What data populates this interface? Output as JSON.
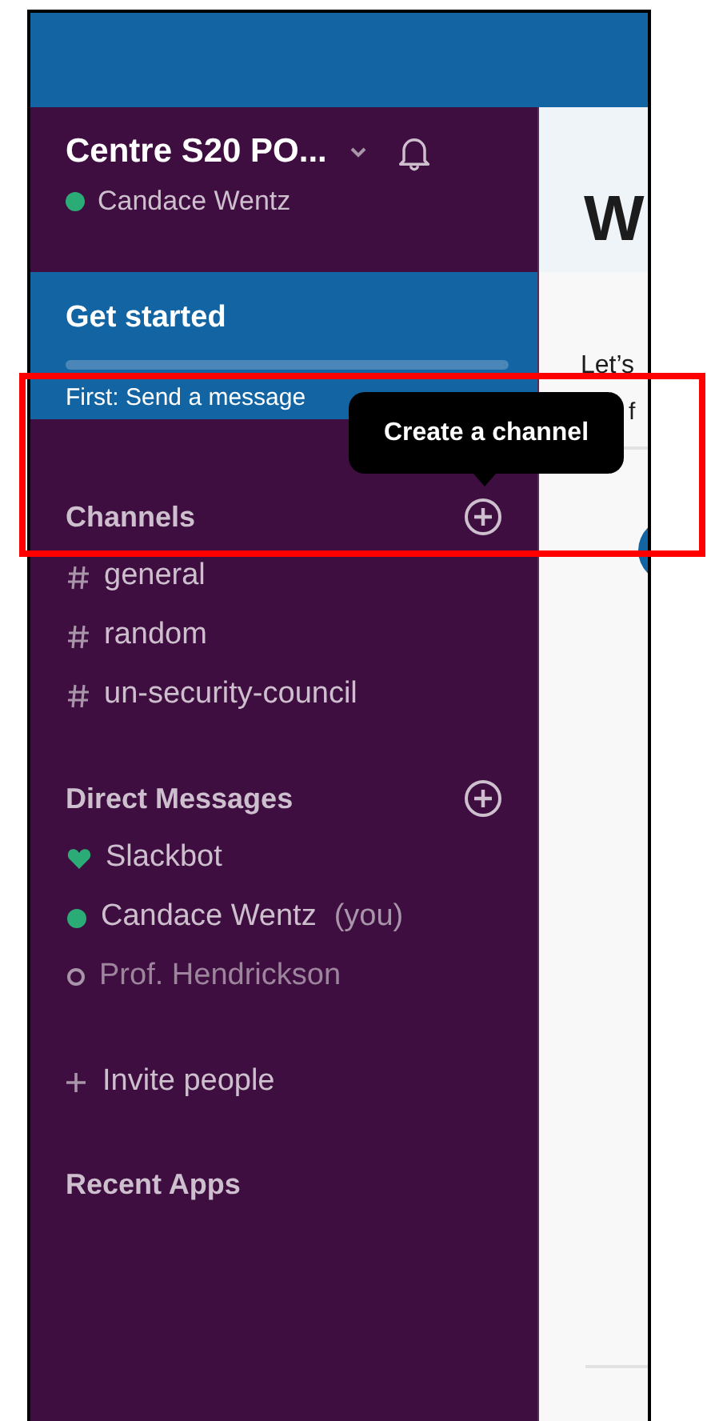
{
  "workspace": {
    "name": "Centre S20 PO...",
    "user": "Candace Wentz",
    "online": true
  },
  "onboarding": {
    "title": "Get started",
    "level": 0,
    "step": "First: Send a message"
  },
  "tooltip": "Create a channel",
  "channels": {
    "title": "Channels",
    "items": [
      {
        "name": "general"
      },
      {
        "name": "random"
      },
      {
        "name": "un-security-council"
      }
    ]
  },
  "direct_messages": {
    "title": "Direct Messages",
    "items": [
      {
        "name": "Slackbot",
        "kind": "bot"
      },
      {
        "name": "Candace Wentz",
        "suffix": "(you)",
        "kind": "active"
      },
      {
        "name": "Prof. Hendrickson",
        "kind": "away"
      }
    ]
  },
  "invite": "Invite people",
  "recent_apps": "Recent Apps",
  "main": {
    "heading": "W",
    "line_1": "Let’s",
    "line_2": "f"
  }
}
